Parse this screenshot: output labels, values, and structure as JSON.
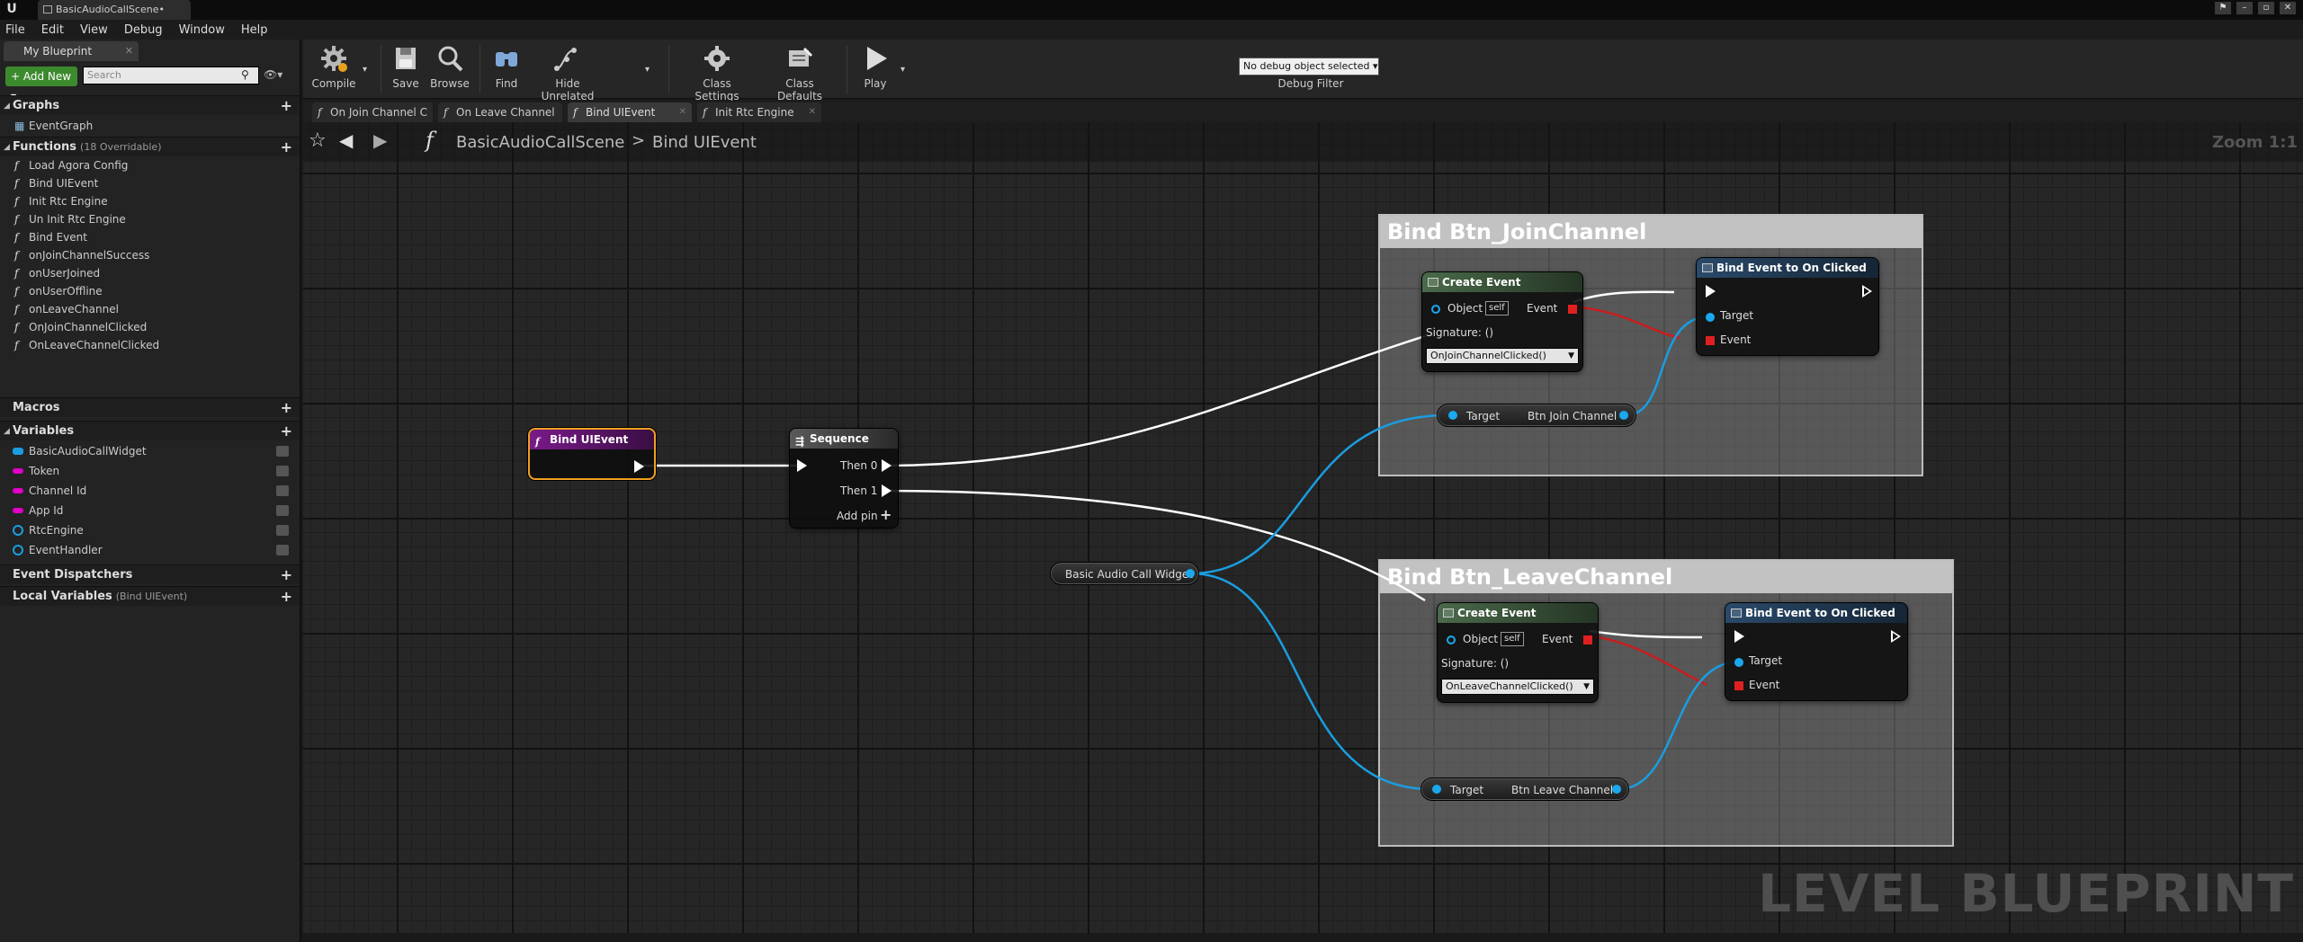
{
  "window": {
    "doc_tab": "BasicAudioCallScene•"
  },
  "menu": [
    "File",
    "Edit",
    "View",
    "Debug",
    "Window",
    "Help"
  ],
  "left": {
    "tab": "My Blueprint",
    "add_new": "+ Add New ▾",
    "search_placeholder": "Search",
    "graphs": {
      "title": "Graphs",
      "items": [
        "EventGraph"
      ]
    },
    "functions": {
      "title": "Functions",
      "note": "(18 Overridable)",
      "items": [
        "Load Agora Config",
        "Bind UIEvent",
        "Init Rtc Engine",
        "Un Init Rtc Engine",
        "Bind Event",
        "onJoinChannelSuccess",
        "onUserJoined",
        "onUserOffline",
        "onLeaveChannel",
        "OnJoinChannelClicked",
        "OnLeaveChannelClicked"
      ]
    },
    "macros": {
      "title": "Macros"
    },
    "variables": {
      "title": "Variables",
      "items": [
        {
          "name": "BasicAudioCallWidget",
          "type": "widget",
          "color": "#1a9de0"
        },
        {
          "name": "Token",
          "type": "string",
          "color": "#e000c8"
        },
        {
          "name": "Channel Id",
          "type": "string",
          "color": "#e000c8"
        },
        {
          "name": "App Id",
          "type": "string",
          "color": "#e000c8"
        },
        {
          "name": "RtcEngine",
          "type": "object",
          "color": "#1a9de0"
        },
        {
          "name": "EventHandler",
          "type": "object",
          "color": "#1a9de0"
        }
      ]
    },
    "dispatchers": {
      "title": "Event Dispatchers"
    },
    "local_vars": {
      "title": "Local Variables",
      "note": "(Bind UIEvent)"
    }
  },
  "toolbar": {
    "compile": "Compile",
    "save": "Save",
    "browse": "Browse",
    "find": "Find",
    "hide_unrelated": "Hide Unrelated",
    "class_settings": "Class Settings",
    "class_defaults": "Class Defaults",
    "play": "Play",
    "debug_select": "No debug object selected ▾",
    "debug_filter": "Debug Filter"
  },
  "graph_tabs": [
    "On Join Channel C",
    "On Leave Channel",
    "Bind UIEvent",
    "Init Rtc Engine"
  ],
  "breadcrumb": {
    "scene": "BasicAudioCallScene",
    "sep": ">",
    "function": "Bind UIEvent",
    "zoom": "Zoom 1:1"
  },
  "watermark": "LEVEL BLUEPRINT",
  "nodes": {
    "bind_uievent": {
      "title": "Bind UIEvent"
    },
    "sequence": {
      "title": "Sequence",
      "then0": "Then 0",
      "then1": "Then 1",
      "add_pin": "Add pin"
    },
    "widget_var": {
      "label": "Basic Audio Call Widget"
    },
    "comment_join": {
      "title": "Bind Btn_JoinChannel"
    },
    "comment_leave": {
      "title": "Bind Btn_LeaveChannel"
    },
    "create_join": {
      "title": "Create Event",
      "object": "Object",
      "self": "self",
      "event": "Event",
      "signature": "Signature: ()",
      "func": "OnJoinChannelClicked()"
    },
    "bind_join": {
      "title": "Bind Event to On Clicked",
      "target": "Target",
      "event": "Event"
    },
    "get_join": {
      "target": "Target",
      "label": "Btn Join Channel"
    },
    "create_leave": {
      "title": "Create Event",
      "object": "Object",
      "self": "self",
      "event": "Event",
      "signature": "Signature: ()",
      "func": "OnLeaveChannelClicked()"
    },
    "bind_leave": {
      "title": "Bind Event to On Clicked",
      "target": "Target",
      "event": "Event"
    },
    "get_leave": {
      "target": "Target",
      "label": "Btn Leave Channel"
    }
  }
}
